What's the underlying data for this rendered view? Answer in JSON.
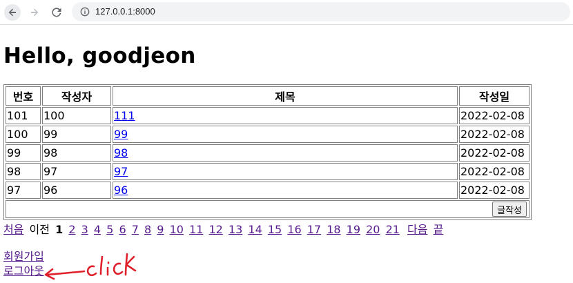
{
  "browser": {
    "url": "127.0.0.1:8000"
  },
  "page": {
    "title": "Hello, goodjeon"
  },
  "table": {
    "headers": [
      "번호",
      "작성자",
      "제목",
      "작성일"
    ],
    "rows": [
      {
        "no": "101",
        "writer": "100",
        "subject": "111",
        "date": "2022-02-08"
      },
      {
        "no": "100",
        "writer": "99",
        "subject": "99",
        "date": "2022-02-08"
      },
      {
        "no": "99",
        "writer": "98",
        "subject": "98",
        "date": "2022-02-08"
      },
      {
        "no": "98",
        "writer": "97",
        "subject": "97",
        "date": "2022-02-08"
      },
      {
        "no": "97",
        "writer": "96",
        "subject": "96",
        "date": "2022-02-08"
      }
    ],
    "write_button": "글작성"
  },
  "pager": {
    "first": "처음",
    "prev": "이전",
    "current": "1",
    "pages": [
      "2",
      "3",
      "4",
      "5",
      "6",
      "7",
      "8",
      "9",
      "10",
      "11",
      "12",
      "13",
      "14",
      "15",
      "16",
      "17",
      "18",
      "19",
      "20",
      "21"
    ],
    "next": "다음",
    "last": "끝"
  },
  "member": {
    "signup": "회원가입",
    "logout": "로그아웃"
  },
  "annotation": {
    "text": "click",
    "color": "#e0202a"
  },
  "icons": {
    "back": "arrow-back-icon",
    "forward": "arrow-forward-icon",
    "reload": "reload-icon",
    "info": "info-icon"
  }
}
